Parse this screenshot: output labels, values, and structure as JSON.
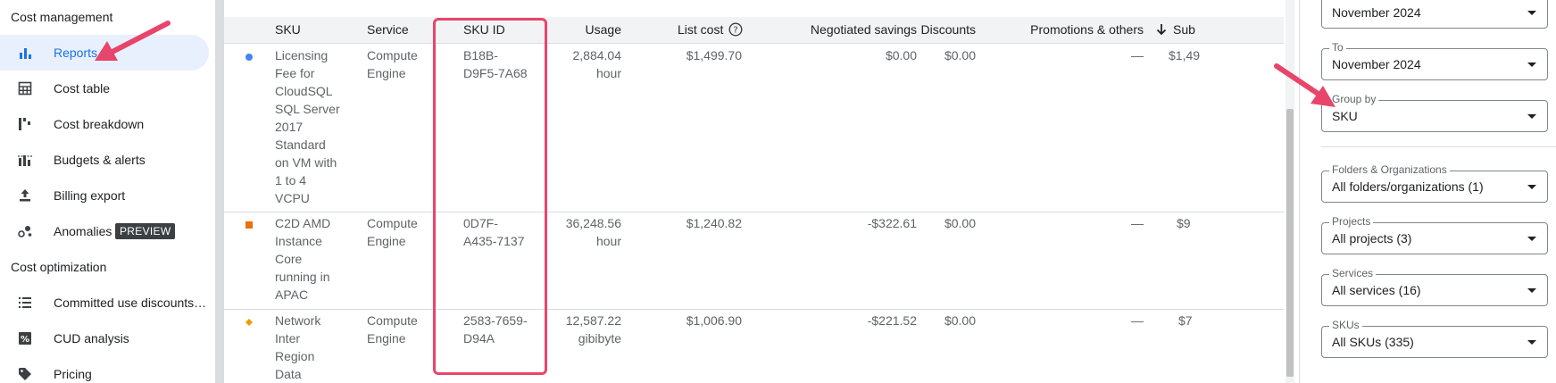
{
  "colors": {
    "accent_blue": "#1a73e8",
    "annotation_pink": "#e8456b",
    "series_blue": "#4285f4",
    "series_orange_red": "#e8710a",
    "series_orange": "#f29900"
  },
  "sidebar": {
    "section_cost_management": "Cost management",
    "section_cost_optimization": "Cost optimization",
    "items": [
      {
        "label": "Reports",
        "icon": "bar-chart-icon",
        "active": true
      },
      {
        "label": "Cost table",
        "icon": "table-icon"
      },
      {
        "label": "Cost breakdown",
        "icon": "waterfall-chart-icon"
      },
      {
        "label": "Budgets & alerts",
        "icon": "budget-chart-icon"
      },
      {
        "label": "Billing export",
        "icon": "export-icon"
      },
      {
        "label": "Anomalies",
        "icon": "anomalies-icon",
        "badge": "PREVIEW"
      },
      {
        "label": "Committed use discounts…",
        "icon": "list-icon"
      },
      {
        "label": "CUD analysis",
        "icon": "percent-icon"
      },
      {
        "label": "Pricing",
        "icon": "tag-icon"
      }
    ]
  },
  "table": {
    "headers": {
      "sku": "SKU",
      "service": "Service",
      "sku_id": "SKU ID",
      "usage": "Usage",
      "list_cost": "List cost",
      "negotiated_savings": "Negotiated savings",
      "discounts": "Discounts",
      "promotions": "Promotions & others",
      "subtotal": "Sub"
    },
    "rows": [
      {
        "sku": "Licensing Fee for CloudSQL SQL Server 2017 Standard on VM with 1 to 4 VCPU",
        "sku_lines": [
          "Licensing",
          "Fee for",
          "CloudSQL",
          "SQL Server",
          "2017",
          "Standard",
          "on VM with",
          "1 to 4",
          "VCPU"
        ],
        "service_lines": [
          "Compute",
          "Engine"
        ],
        "sku_id_lines": [
          "B18B-",
          "D9F5-7A68"
        ],
        "usage_lines": [
          "2,884.04",
          "hour"
        ],
        "list_cost": "$1,499.70",
        "negotiated_savings": "$0.00",
        "discounts": "$0.00",
        "promotions": "—",
        "subtotal": "$1,49"
      },
      {
        "sku_lines": [
          "C2D AMD",
          "Instance",
          "Core",
          "running in",
          "APAC"
        ],
        "service_lines": [
          "Compute",
          "Engine"
        ],
        "sku_id_lines": [
          "0D7F-",
          "A435-7137"
        ],
        "usage_lines": [
          "36,248.56",
          "hour"
        ],
        "list_cost": "$1,240.82",
        "negotiated_savings": "-$322.61",
        "discounts": "$0.00",
        "promotions": "—",
        "subtotal": "$9"
      },
      {
        "sku_lines": [
          "Network",
          "Inter",
          "Region",
          "Data"
        ],
        "service_lines": [
          "Compute",
          "Engine"
        ],
        "sku_id_lines": [
          "2583-7659-",
          "D94A"
        ],
        "usage_lines": [
          "12,587.22",
          "gibibyte"
        ],
        "list_cost": "$1,006.90",
        "negotiated_savings": "-$221.52",
        "discounts": "$0.00",
        "promotions": "—",
        "subtotal": "$7"
      }
    ]
  },
  "filters": {
    "from_value": "November 2024",
    "to_label": "To",
    "to_value": "November 2024",
    "group_by_label": "Group by",
    "group_by_value": "SKU",
    "folders_label": "Folders & Organizations",
    "folders_value": "All folders/organizations (1)",
    "projects_label": "Projects",
    "projects_value": "All projects (3)",
    "services_label": "Services",
    "services_value": "All services (16)",
    "skus_label": "SKUs",
    "skus_value": "All SKUs (335)"
  }
}
